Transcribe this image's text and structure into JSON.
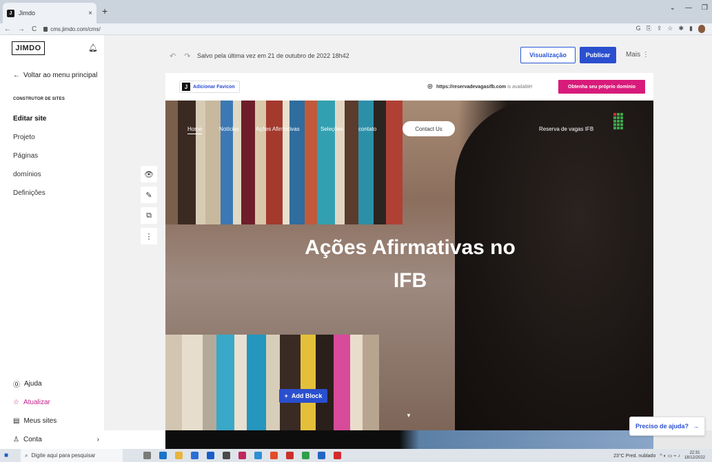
{
  "browser": {
    "tab_title": "Jimdo",
    "tab_close": "×",
    "new_tab": "+",
    "url": "cms.jimdo.com/cms/",
    "nav_back": "←",
    "nav_forward": "→",
    "nav_reload": "C",
    "window_min": "—",
    "window_max": "❐",
    "window_chevron": "⌄"
  },
  "sidebar": {
    "logo": "JIMDO",
    "back_label": "Voltar ao menu principal",
    "section_label": "CONSTRUTOR DE SITES",
    "items": [
      {
        "label": "Editar site",
        "active": true
      },
      {
        "label": "Projeto",
        "active": false
      },
      {
        "label": "Páginas",
        "active": false
      },
      {
        "label": "domínios",
        "active": false
      },
      {
        "label": "Definições",
        "active": false
      }
    ],
    "bottom": [
      {
        "label": "Ajuda",
        "icon": "help-icon"
      },
      {
        "label": "Atualizar",
        "icon": "star-icon"
      },
      {
        "label": "Meus sites",
        "icon": "sites-icon"
      },
      {
        "label": "Conta",
        "icon": "user-icon"
      }
    ]
  },
  "toolbar": {
    "saved_text": "Salvo pela última vez em 21 de outubro de 2022 18h42",
    "preview_label": "Visualização",
    "publish_label": "Publicar",
    "more_label": "Mais"
  },
  "site_bar": {
    "favicon_label": "Adicionar Favicon",
    "domain_url": "https://reservadevagasifb.com",
    "domain_avail": " is available!",
    "domain_button": "Obtenha seu próprio domínio"
  },
  "site_nav": {
    "items": [
      "Home",
      "Notícias",
      "Ações Afirmativas",
      "Seleções",
      "contato"
    ],
    "contact_button": "Contact Us",
    "right_label": "Reserva de vagas IFB"
  },
  "hero": {
    "title_line1": "Ações Afirmativas no",
    "title_line2": "IFB"
  },
  "add_block_label": "Add Block",
  "help_label": "Preciso de ajuda?",
  "taskbar": {
    "search_placeholder": "Digite aqui para pesquisar",
    "weather": "23°C Pred. nublado",
    "time": "22:31",
    "date": "18/12/2022"
  },
  "colors": {
    "accent": "#2a4fcf",
    "domain_button": "#d81b7a",
    "update_link": "#c1208c"
  }
}
